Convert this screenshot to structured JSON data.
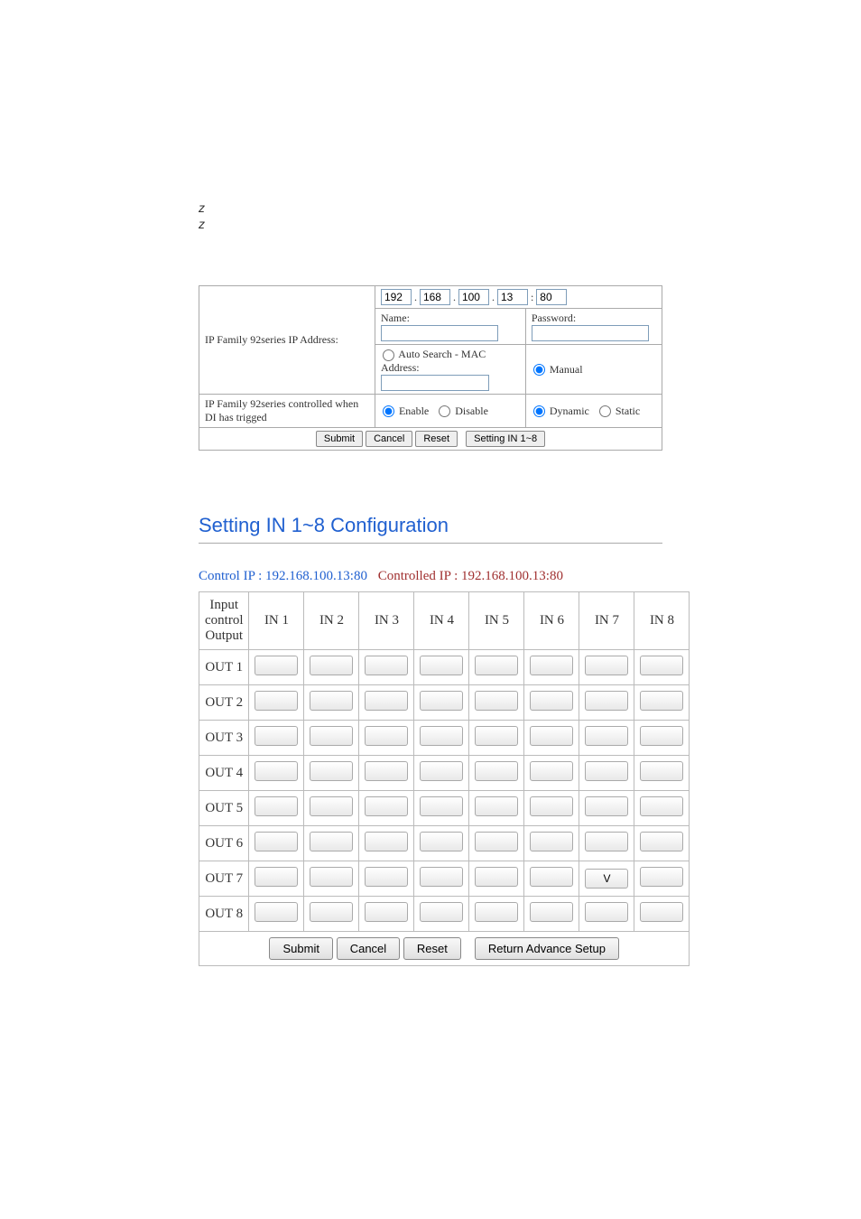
{
  "form": {
    "label_ip": "IP Family 92series IP Address:",
    "ip": {
      "o1": "192",
      "o2": "168",
      "o3": "100",
      "o4": "13",
      "port": "80"
    },
    "name_label": "Name:",
    "name": "",
    "password_label": "Password:",
    "password": "",
    "auto_label": "Auto Search - MAC Address:",
    "mac": "",
    "manual_label": "Manual",
    "di_label": "IP Family 92series controlled when DI has trigged",
    "enable_label": "Enable",
    "disable_label": "Disable",
    "dynamic_label": "Dynamic",
    "static_label": "Static",
    "submit": "Submit",
    "cancel": "Cancel",
    "reset": "Reset",
    "setting_btn": "Setting IN 1~8"
  },
  "config": {
    "title": "Setting IN 1~8 Configuration",
    "control_ip_label": "Control IP : 192.168.100.13:80",
    "controlled_ip_label": "Controlled IP : 192.168.100.13:80",
    "col_header": "Input control Output",
    "ins": [
      "IN 1",
      "IN 2",
      "IN 3",
      "IN 4",
      "IN 5",
      "IN 6",
      "IN 7",
      "IN 8"
    ],
    "outs": [
      "OUT 1",
      "OUT 2",
      "OUT 3",
      "OUT 4",
      "OUT 5",
      "OUT 6",
      "OUT 7",
      "OUT 8"
    ],
    "footer": {
      "submit": "Submit",
      "cancel": "Cancel",
      "reset": "Reset",
      "return": "Return Advance Setup"
    }
  }
}
